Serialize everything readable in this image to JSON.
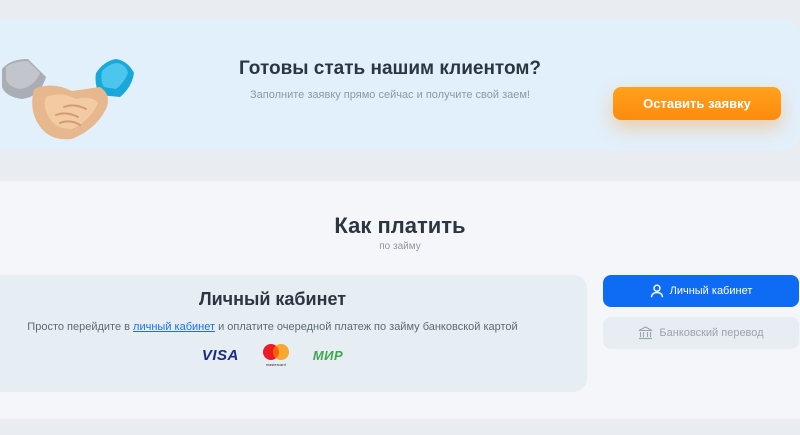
{
  "cta": {
    "title": "Готовы стать нашим клиентом?",
    "subtitle": "Заполните заявку прямо сейчас и получите свой заем!",
    "button_label": "Оставить заявку",
    "illustration_icon": "handshake-illustration"
  },
  "how_to_pay": {
    "title": "Как платить",
    "subtitle": "по займу",
    "method": {
      "title": "Личный кабинет",
      "desc_before": "Просто перейдите в ",
      "desc_link": "личный кабинет",
      "desc_after": " и оплатите очередной платеж по займу банковской картой",
      "logos": {
        "visa": "VISA",
        "mastercard": "mastercard",
        "mir": "МИР"
      }
    },
    "tabs": [
      {
        "label": "Личный кабинет",
        "icon": "user-icon",
        "active": true
      },
      {
        "label": "Банковский перевод",
        "icon": "bank-icon",
        "active": false
      }
    ]
  },
  "colors": {
    "accent_orange": "#ff8a0d",
    "accent_blue": "#0e6cf4",
    "link_blue": "#1e6ff0"
  }
}
